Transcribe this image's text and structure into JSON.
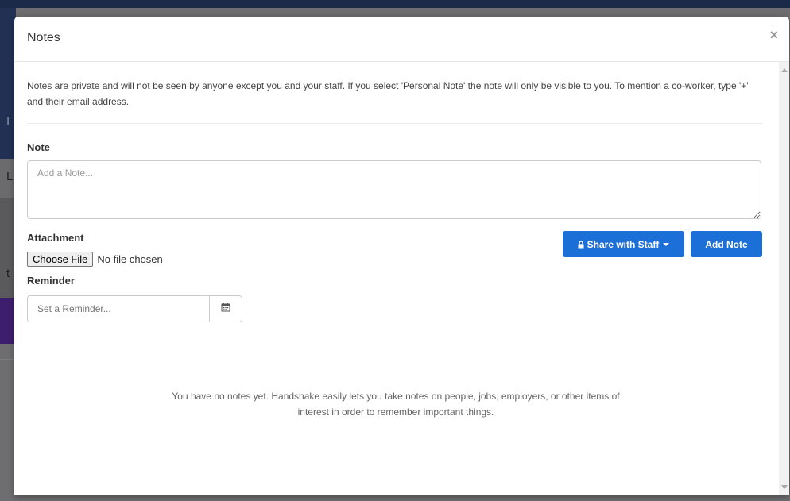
{
  "backdrop": {
    "chars": [
      "I",
      "L",
      "t"
    ]
  },
  "modal": {
    "title": "Notes",
    "close_label": "×",
    "intro": "Notes are private and will not be seen by anyone except you and your staff. If you select 'Personal Note' the note will only be visible to you. To mention a co-worker, type '+' and their email address.",
    "note": {
      "label": "Note",
      "placeholder": "Add a Note...",
      "value": ""
    },
    "attachment": {
      "label": "Attachment",
      "button_label": "Choose File",
      "status": "No file chosen"
    },
    "reminder": {
      "label": "Reminder",
      "placeholder": "Set a Reminder...",
      "icon": "calendar-icon"
    },
    "share_button": {
      "label": "Share with Staff",
      "icon": "lock-icon"
    },
    "add_button": {
      "label": "Add Note"
    },
    "empty_message": "You have no notes yet. Handshake easily lets you take notes on people, jobs, employers, or other items of interest in order to remember important things."
  },
  "colors": {
    "primary": "#1d6fd8",
    "backdrop_header": "#213053",
    "backdrop_purple": "#3d1e6e"
  }
}
